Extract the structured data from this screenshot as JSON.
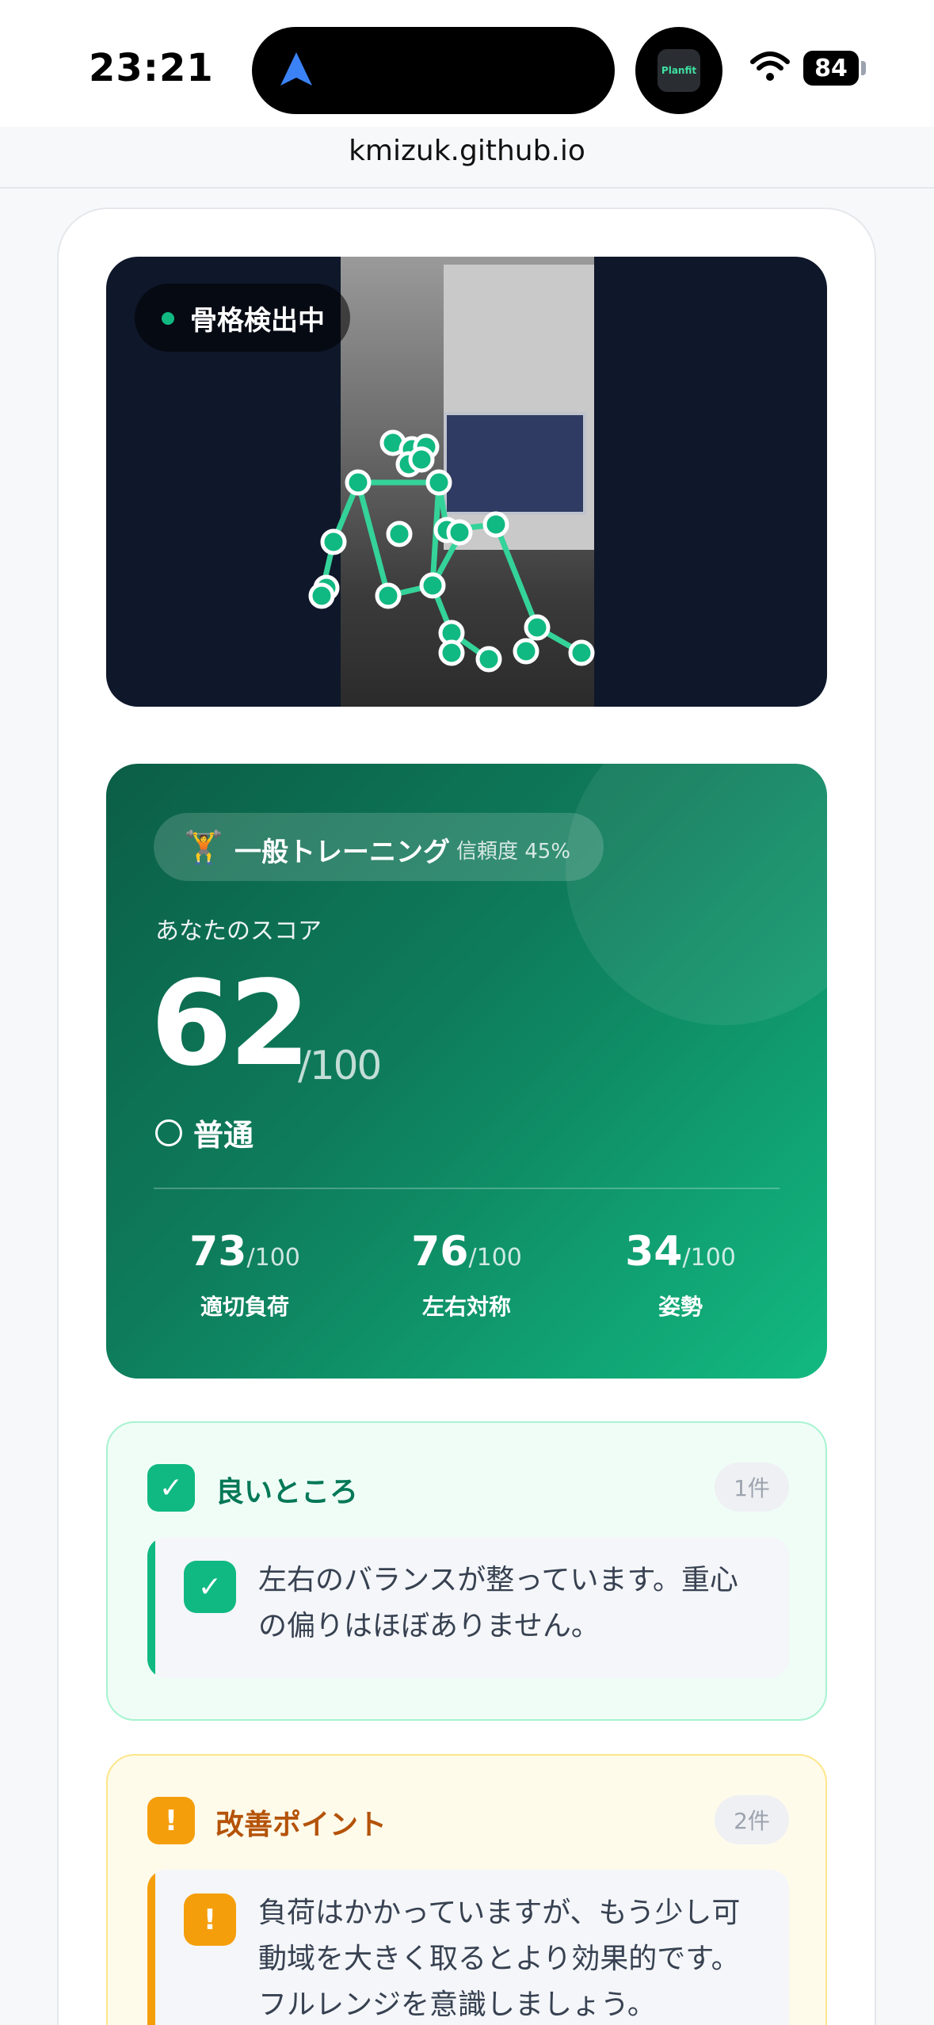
{
  "status_bar": {
    "time": "23:21",
    "battery": "84",
    "app_icon_label": "Planfit"
  },
  "browser": {
    "url": "kmizuk.github.io"
  },
  "video": {
    "badge_label": "骨格検出中"
  },
  "score_card": {
    "exercise_icon": "🏋",
    "exercise_type": "一般トレーニング",
    "confidence": "信頼度 45%",
    "title": "あなたのスコア",
    "score": "62",
    "score_max": "/100",
    "rating": "普通",
    "metrics": [
      {
        "value": "73",
        "max": "/100",
        "label": "適切負荷"
      },
      {
        "value": "76",
        "max": "/100",
        "label": "左右対称"
      },
      {
        "value": "34",
        "max": "/100",
        "label": "姿勢"
      }
    ]
  },
  "good_section": {
    "icon": "✓",
    "title": "良いところ",
    "count": "1件",
    "items": [
      {
        "icon": "✓",
        "text": "左右のバランスが整っています。重心の偏りはほぼありません。"
      }
    ]
  },
  "improve_section": {
    "icon": "!",
    "title": "改善ポイント",
    "count": "2件",
    "items": [
      {
        "icon": "!",
        "text": "負荷はかかっていますが、もう少し可動域を大きく取るとより効果的です。フルレンジを意識しましょう。"
      }
    ]
  },
  "colors": {
    "accent": "#10b981",
    "score_dark": "#0b5e46",
    "warn": "#f59e0b",
    "good_title": "#047857",
    "warn_title": "#b45309"
  }
}
